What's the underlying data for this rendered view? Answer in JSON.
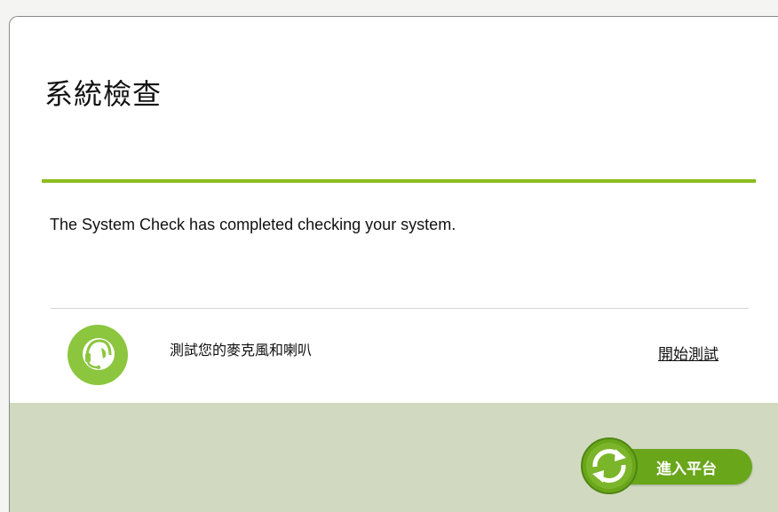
{
  "dialog": {
    "title": "系統檢查",
    "message": "The System Check has completed checking your system.",
    "accent_color": "#8cbd1e"
  },
  "checks": [
    {
      "icon": "headset-icon",
      "label": "測試您的麥克風和喇叭",
      "action_label": "開始測試"
    }
  ],
  "footer": {
    "enter_label": "進入平台",
    "enter_icon": "refresh-icon",
    "background_color": "#d1dac0",
    "button_color": "#69a61a"
  }
}
